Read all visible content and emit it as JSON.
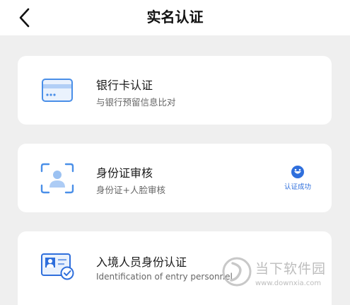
{
  "header": {
    "title": "实名认证"
  },
  "cards": [
    {
      "title": "银行卡认证",
      "subtitle": "与银行预留信息比对"
    },
    {
      "title": "身份证审核",
      "subtitle": "身份证+人脸审核",
      "status": "认证成功"
    },
    {
      "title": "入境人员身份认证",
      "subtitle": "Identification of entry personnel"
    }
  ],
  "watermark": {
    "brand": "当下软件园",
    "url": "www.downxia.com"
  },
  "icons": {
    "back": "chevron-left-icon",
    "card1": "bank-card-icon",
    "card2": "face-scan-icon",
    "card3": "id-card-check-icon",
    "status": "smile-icon"
  },
  "colors": {
    "accent": "#4a8fe8",
    "status": "#2f6fdc"
  }
}
